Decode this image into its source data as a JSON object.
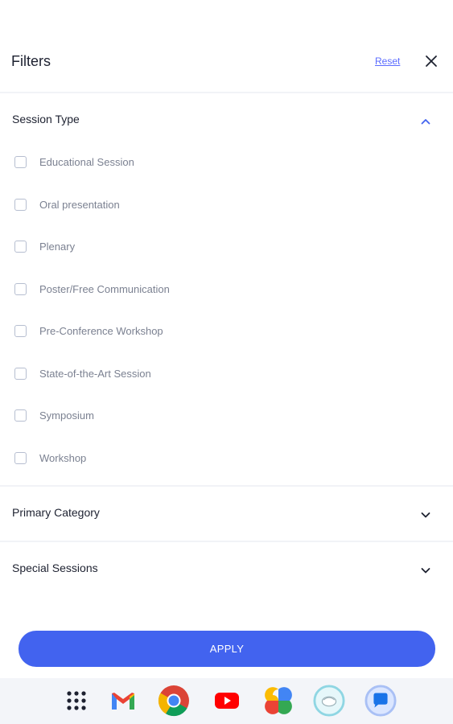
{
  "header": {
    "title": "Filters",
    "reset_label": "Reset",
    "close_icon": "close-icon"
  },
  "sections": [
    {
      "title": "Session Type",
      "expanded": true,
      "options": [
        {
          "label": "Educational Session",
          "checked": false
        },
        {
          "label": "Oral presentation",
          "checked": false
        },
        {
          "label": "Plenary",
          "checked": false
        },
        {
          "label": "Poster/Free Communication",
          "checked": false
        },
        {
          "label": "Pre-Conference Workshop",
          "checked": false
        },
        {
          "label": "State-of-the-Art Session",
          "checked": false
        },
        {
          "label": "Symposium",
          "checked": false
        },
        {
          "label": "Workshop",
          "checked": false
        }
      ]
    },
    {
      "title": "Primary Category",
      "expanded": false
    },
    {
      "title": "Special Sessions",
      "expanded": false
    }
  ],
  "apply_label": "APPLY",
  "dock": {
    "apps": [
      "app-grid-icon",
      "gmail-icon",
      "chrome-icon",
      "youtube-icon",
      "photos-icon",
      "assistant-icon",
      "messages-icon"
    ]
  },
  "colors": {
    "accent": "#4263ef",
    "link": "#5b6cff",
    "text": "#1d2130",
    "muted_text": "#7b8191",
    "checkbox_border": "#b6bed0"
  }
}
